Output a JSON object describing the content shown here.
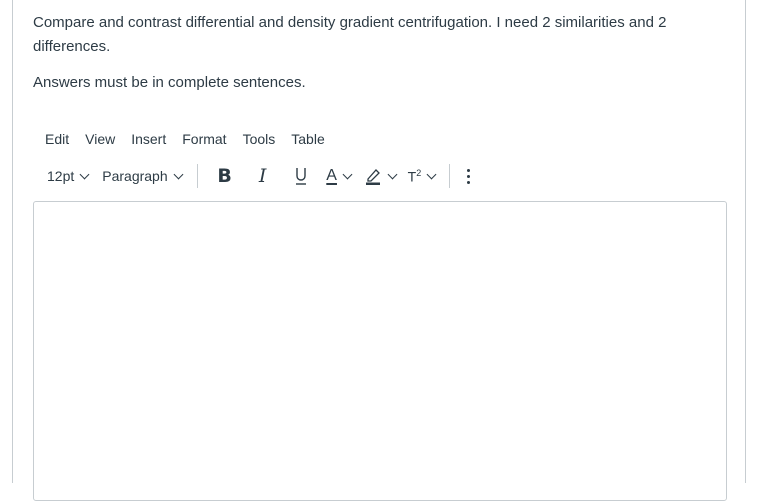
{
  "question": {
    "line1": "Compare and contrast differential and density gradient centrifugation.  I need 2 similarities and 2 differences.",
    "line2": "Answers must be in complete sentences."
  },
  "menubar": {
    "items": [
      "Edit",
      "View",
      "Insert",
      "Format",
      "Tools",
      "Table"
    ]
  },
  "toolbar": {
    "font_size": "12pt",
    "block_format": "Paragraph",
    "bold_label": "B",
    "italic_label": "I",
    "underline_label": "U",
    "font_color_label": "A",
    "superscript_label": "T",
    "superscript_mark": "2"
  },
  "editor": {
    "content": ""
  }
}
